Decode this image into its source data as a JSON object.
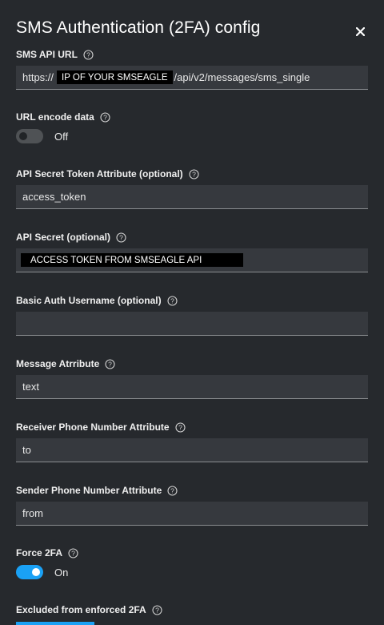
{
  "header": {
    "title": "SMS Authentication (2FA) config"
  },
  "fields": {
    "api_url": {
      "label": "SMS API URL",
      "prefix": "https://",
      "redacted": "IP OF YOUR SMSEAGLE",
      "suffix": "/api/v2/messages/sms_single"
    },
    "url_encode": {
      "label": "URL encode data",
      "state": "Off"
    },
    "token_attr": {
      "label": "API Secret Token Attribute (optional)",
      "value": "access_token"
    },
    "secret": {
      "label": "API Secret (optional)",
      "redacted": "ACCESS TOKEN FROM SMSEAGLE API"
    },
    "basic_auth": {
      "label": "Basic Auth Username (optional)",
      "value": ""
    },
    "message_attr": {
      "label": "Message Atrribute",
      "value": "text"
    },
    "receiver_attr": {
      "label": "Receiver Phone Number Attribute",
      "value": "to"
    },
    "sender_attr": {
      "label": "Sender Phone Number Attribute",
      "value": "from"
    },
    "force_2fa": {
      "label": "Force 2FA",
      "state": "On"
    },
    "excluded": {
      "label": "Excluded from enforced 2FA"
    }
  },
  "colors": {
    "background": "#26292d",
    "input": "#36393e",
    "accent": "#1aa1f5"
  },
  "icons": {
    "close": "close-icon",
    "help": "help-circle-icon"
  }
}
